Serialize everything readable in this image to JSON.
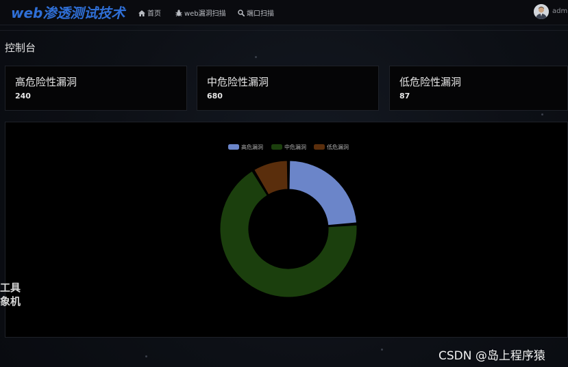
{
  "header": {
    "brand": "web渗透测试技术",
    "nav": [
      {
        "label": "首页",
        "icon": "home-icon"
      },
      {
        "label": "web漏洞扫描",
        "icon": "bug-icon"
      },
      {
        "label": "端口扫描",
        "icon": "search-icon"
      }
    ],
    "user": "admi"
  },
  "page": {
    "title": "控制台"
  },
  "cards": [
    {
      "title": "高危险性漏洞",
      "value": "240"
    },
    {
      "title": "中危险性漏洞",
      "value": "680"
    },
    {
      "title": "低危险性漏洞",
      "value": "87"
    }
  ],
  "sidebar_fragments": [
    "工具",
    "象机"
  ],
  "chart_data": {
    "type": "pie",
    "donut": true,
    "labels": [
      "高危漏洞",
      "中危漏洞",
      "低危漏洞"
    ],
    "values": [
      240,
      680,
      87
    ],
    "colors": [
      "#6b85c9",
      "#1b3f0d",
      "#5a2e0c"
    ],
    "legend": "top-center"
  },
  "watermark": "CSDN @岛上程序猿"
}
